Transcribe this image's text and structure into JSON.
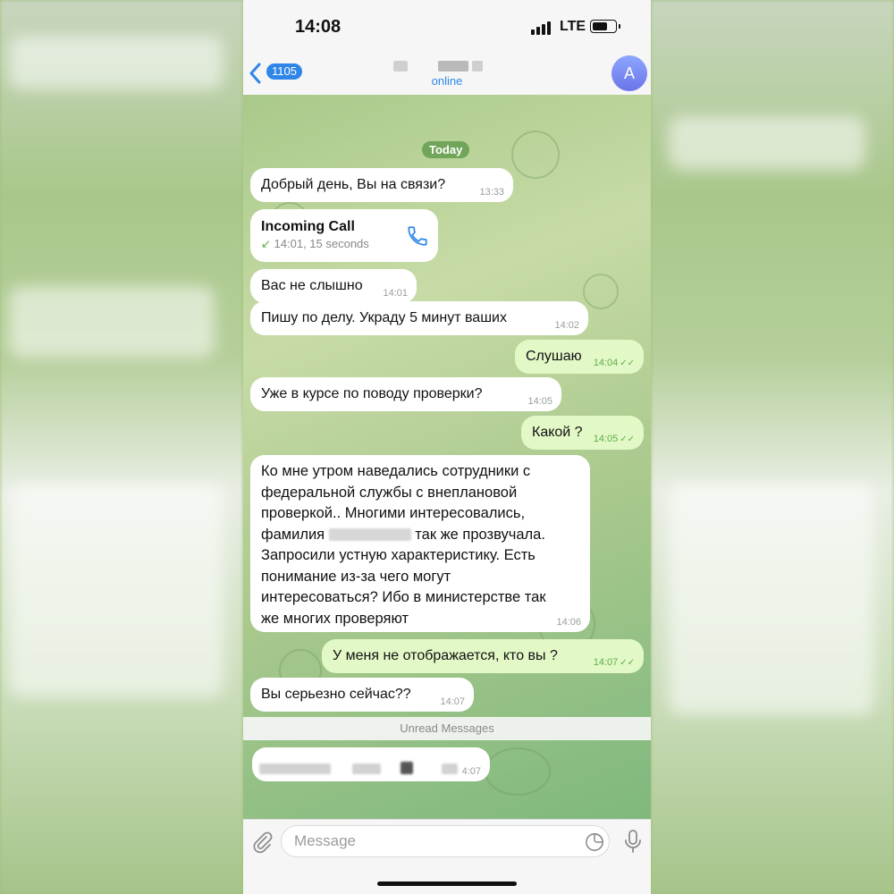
{
  "status_bar": {
    "time": "14:08",
    "network": "LTE",
    "battery_level": 0.65
  },
  "header": {
    "back_badge": "1105",
    "contact_status": "online",
    "avatar_initial": "A"
  },
  "chat": {
    "date_label": "Today",
    "messages": [
      {
        "dir": "in",
        "text": "Добрый день, Вы на связи?",
        "time": "13:33"
      },
      {
        "dir": "in",
        "type": "call",
        "title": "Incoming Call",
        "detail": "14:01, 15 seconds",
        "arrow": "↙"
      },
      {
        "dir": "in",
        "text": "Вас не слышно",
        "time": "14:01"
      },
      {
        "dir": "in",
        "text": "Пишу по делу. Украду 5 минут ваших",
        "time": "14:02"
      },
      {
        "dir": "out",
        "text": "Слушаю",
        "time": "14:04"
      },
      {
        "dir": "in",
        "text": "Уже в курсе по поводу проверки?",
        "time": "14:05"
      },
      {
        "dir": "out",
        "text": "Какой ?",
        "time": "14:05"
      },
      {
        "dir": "in",
        "text_before": "Ко мне утром наведались сотрудники с\nфедеральной службы с внеплановой\nпроверкой.. Многими интересовались,\nфамилия ",
        "text_after": " так же прозвучала.\nЗапросили устную характеристику. Есть\nпонимание из-за чего могут\nинтересоваться? Ибо в министерстве так\nже многих проверяют",
        "time": "14:06"
      },
      {
        "dir": "out",
        "text": "У меня не отображается, кто вы ?",
        "time": "14:07"
      },
      {
        "dir": "in",
        "text": "Вы серьезно сейчас??",
        "time": "14:07"
      }
    ],
    "unread_label": "Unread Messages",
    "last_message_time": "4:07"
  },
  "input_bar": {
    "placeholder": "Message"
  },
  "colors": {
    "accent": "#2f86e8",
    "outgoing_bubble": "#e3f8c7",
    "incoming_bubble": "#ffffff",
    "read_ticks": "#5fae49"
  },
  "icons": [
    "back-chevron-icon",
    "phone-icon",
    "paperclip-icon",
    "sticker-icon",
    "microphone-icon",
    "read-ticks-icon"
  ]
}
